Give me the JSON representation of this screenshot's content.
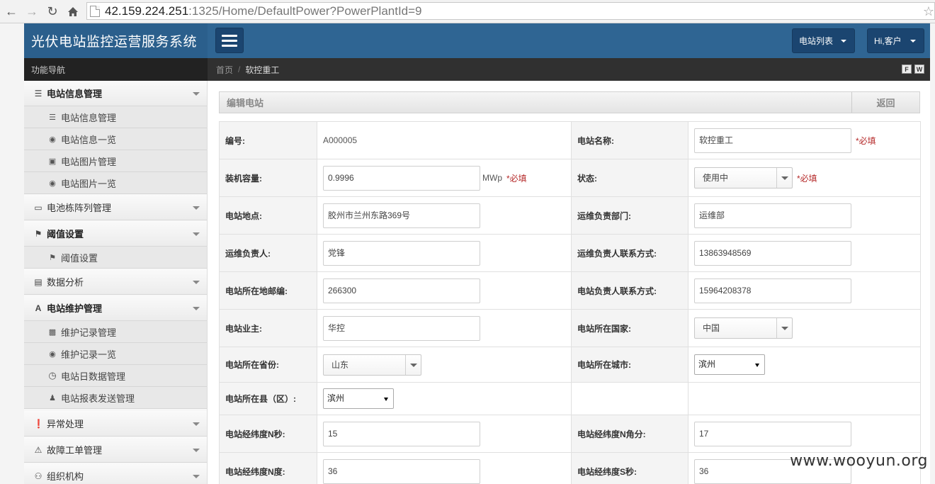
{
  "browser": {
    "url_host": "42.159.224.251",
    "url_rest": ":1325/Home/DefaultPower?PowerPlantId=9"
  },
  "header": {
    "brand": "光伏电站监控运营服务系统",
    "station_list": "电站列表",
    "user_menu": "Hi,客户"
  },
  "subbar": {
    "nav_title": "功能导航",
    "home": "首页",
    "separator": "/",
    "current": "软控重工",
    "btn_f": "F",
    "btn_w": "W"
  },
  "sidebar": {
    "groups": [
      {
        "label": "电站信息管理",
        "icon": "list-icon"
      },
      {
        "label": "电池栋阵列管理",
        "icon": "battery-icon"
      },
      {
        "label": "阈值设置",
        "icon": "flag-icon"
      },
      {
        "label": "数据分析",
        "icon": "hdd-icon"
      },
      {
        "label": "电站维护管理",
        "icon": "font-icon"
      },
      {
        "label": "异常处理",
        "icon": "exclamation-icon"
      },
      {
        "label": "故障工单管理",
        "icon": "warning-icon"
      },
      {
        "label": "组织机构",
        "icon": "users-icon"
      }
    ],
    "subs": [
      {
        "label": "电站信息管理",
        "icon": "list-icon"
      },
      {
        "label": "电站信息一览",
        "icon": "eye-icon"
      },
      {
        "label": "电站图片管理",
        "icon": "picture-icon"
      },
      {
        "label": "电站图片一览",
        "icon": "eye-icon"
      },
      {
        "label": "阈值设置",
        "icon": "flag-icon"
      },
      {
        "label": "维护记录管理",
        "icon": "briefcase-icon"
      },
      {
        "label": "维护记录一览",
        "icon": "eye-icon"
      },
      {
        "label": "电站日数据管理",
        "icon": "clock-icon"
      },
      {
        "label": "电站报表发送管理",
        "icon": "user-icon"
      }
    ]
  },
  "panel": {
    "title": "编辑电站",
    "back": "返回"
  },
  "form": {
    "code_label": "编号:",
    "code_value": "A000005",
    "name_label": "电站名称:",
    "name_value": "软控重工",
    "capacity_label": "装机容量:",
    "capacity_value": "0.9996",
    "capacity_unit": "MWp",
    "status_label": "状态:",
    "status_value": "使用中",
    "location_label": "电站地点:",
    "location_value": "胶州市兰州东路369号",
    "ops_dept_label": "运维负责部门:",
    "ops_dept_value": "运维部",
    "ops_person_label": "运维负责人:",
    "ops_person_value": "党锋",
    "ops_phone_label": "运维负责人联系方式:",
    "ops_phone_value": "13863948569",
    "zip_label": "电站所在地邮编:",
    "zip_value": "266300",
    "station_phone_label": "电站负责人联系方式:",
    "station_phone_value": "15964208378",
    "owner_label": "电站业主:",
    "owner_value": "华控",
    "country_label": "电站所在国家:",
    "country_value": "中国",
    "province_label": "电站所在省份:",
    "province_value": "山东",
    "city_label": "电站所在城市:",
    "city_value": "滨州",
    "county_label": "电站所在县（区）:",
    "county_value": "滨州",
    "lng_sec_label": "电站经纬度N秒:",
    "lng_sec_value": "15",
    "lng_min_label": "电站经纬度N角分:",
    "lng_min_value": "17",
    "lng_deg_label": "电站经纬度N度:",
    "lng_deg_value": "36",
    "lat_sec_label": "电站经纬度S秒:",
    "lat_sec_value": "36",
    "required_mark": "*必填"
  },
  "watermark": "www.wooyun.org"
}
